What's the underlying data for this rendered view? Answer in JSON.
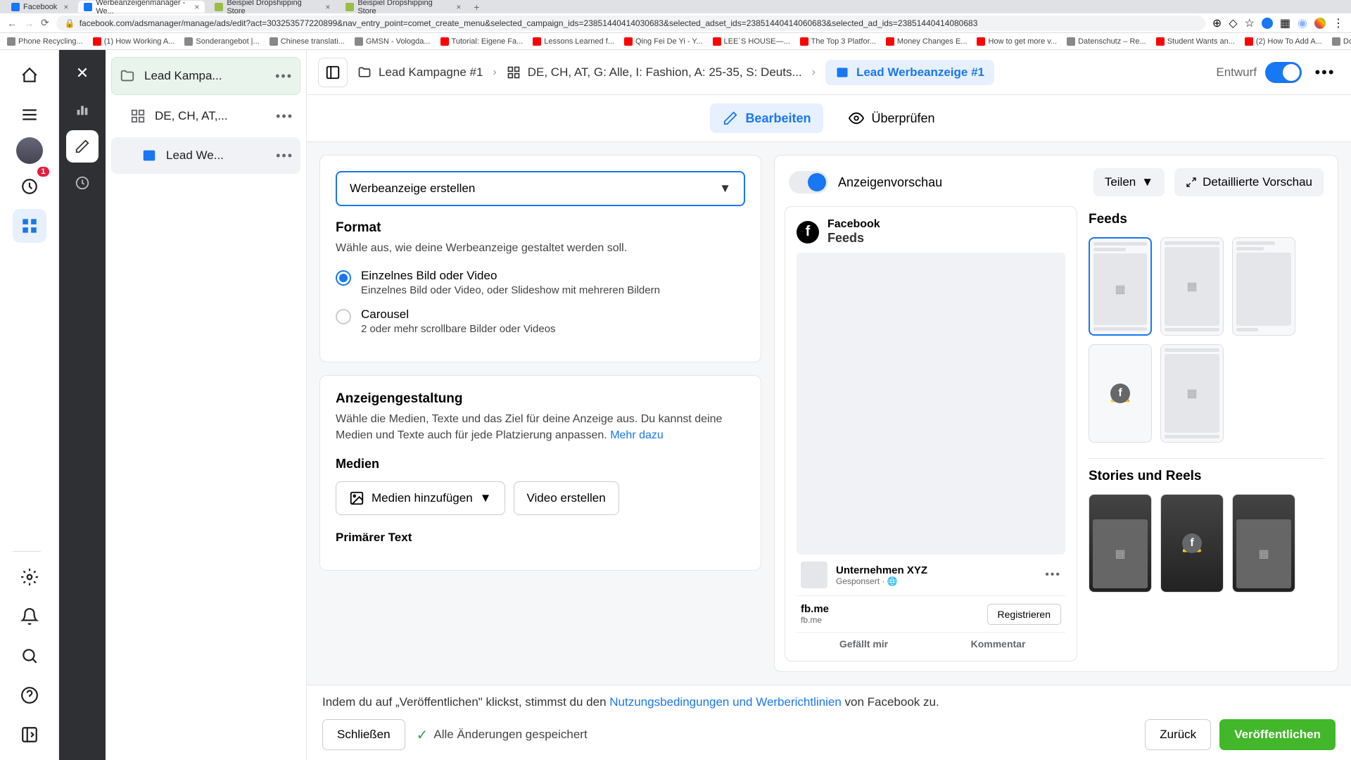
{
  "browser": {
    "tabs": [
      {
        "label": "Facebook",
        "active": false
      },
      {
        "label": "Werbeanzeigenmanager - We...",
        "active": true
      },
      {
        "label": "Beispiel Dropshipping Store",
        "active": false
      },
      {
        "label": "Beispiel Dropshipping Store",
        "active": false
      }
    ],
    "url": "facebook.com/adsmanager/manage/ads/edit?act=303253577220899&nav_entry_point=comet_create_menu&selected_campaign_ids=23851440414030683&selected_adset_ids=23851440414060683&selected_ad_ids=23851440414080683",
    "bookmarks": [
      "Phone Recycling...",
      "(1) How Working A...",
      "Sonderangebot |...",
      "Chinese translati...",
      "GMSN - Vologda...",
      "Tutorial: Eigene Fa...",
      "Lessons Learned f...",
      "Qing Fei De Yi - Y...",
      "LEE´S HOUSE—...",
      "The Top 3 Platfor...",
      "Money Changes E...",
      "How to get more v...",
      "Datenschutz – Re...",
      "Student Wants an...",
      "(2) How To Add A...",
      "Download - Cooki..."
    ]
  },
  "rail": {
    "badge": "1"
  },
  "tree": {
    "items": [
      {
        "label": "Lead Kampa..."
      },
      {
        "label": "DE, CH, AT,..."
      },
      {
        "label": "Lead We..."
      }
    ]
  },
  "topbar": {
    "crumb1": "Lead Kampagne #1",
    "crumb2": "DE, CH, AT, G: Alle, I: Fashion, A: 25-35, S: Deuts...",
    "crumb3": "Lead Werbeanzeige #1",
    "draft": "Entwurf"
  },
  "subtabs": {
    "edit": "Bearbeiten",
    "review": "Überprüfen"
  },
  "form": {
    "create_select": "Werbeanzeige erstellen",
    "format_title": "Format",
    "format_desc": "Wähle aus, wie deine Werbeanzeige gestaltet werden soll.",
    "radio1_title": "Einzelnes Bild oder Video",
    "radio1_desc": "Einzelnes Bild oder Video, oder Slideshow mit mehreren Bildern",
    "radio2_title": "Carousel",
    "radio2_desc": "2 oder mehr scrollbare Bilder oder Videos",
    "design_title": "Anzeigengestaltung",
    "design_desc": "Wähle die Medien, Texte und das Ziel für deine Anzeige aus. Du kannst deine Medien und Texte auch für jede Platzierung anpassen. ",
    "learn_more": "Mehr dazu",
    "media_title": "Medien",
    "add_media": "Medien hinzufügen",
    "create_video": "Video erstellen",
    "primary_text": "Primärer Text"
  },
  "preview": {
    "title": "Anzeigenvorschau",
    "share": "Teilen",
    "detailed": "Detaillierte Vorschau",
    "fb_name": "Facebook",
    "fb_feeds": "Feeds",
    "company": "Unternehmen XYZ",
    "sponsored": "Gesponsert",
    "link": "fb.me",
    "link_sub": "fb.me",
    "cta": "Registrieren",
    "like": "Gefällt mir",
    "comment": "Kommentar",
    "side_feeds": "Feeds",
    "side_stories": "Stories und Reels"
  },
  "footer": {
    "terms_pre": "Indem du auf „Veröffentlichen\" klickst, stimmst du den ",
    "terms_link": "Nutzungsbedingungen und Werberichtlinien",
    "terms_post": " von Facebook zu.",
    "close": "Schließen",
    "saved": "Alle Änderungen gespeichert",
    "back": "Zurück",
    "publish": "Veröffentlichen"
  }
}
